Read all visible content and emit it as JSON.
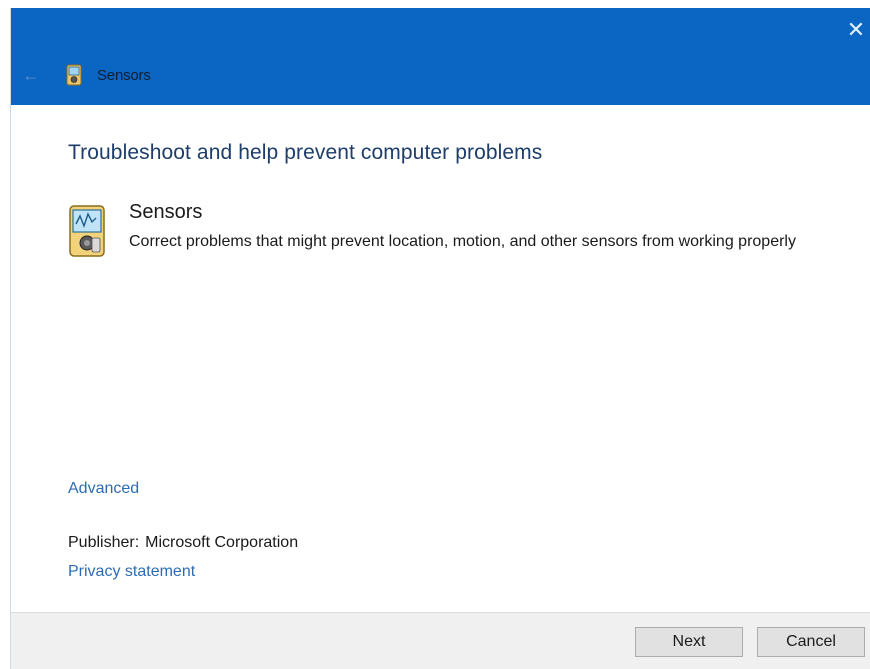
{
  "titlebar": {
    "title": "Sensors",
    "close_symbol": "✕",
    "back_symbol": "←",
    "icon": "sensor-device-icon",
    "color": "#0a66c2"
  },
  "main": {
    "heading": "Troubleshoot and help prevent computer problems",
    "tool": {
      "name": "Sensors",
      "description": "Correct problems that might prevent location, motion, and other sensors from working properly",
      "icon": "sensor-device-icon"
    },
    "advanced_link": "Advanced",
    "publisher_label": "Publisher:",
    "publisher_value": "Microsoft Corporation",
    "privacy_link": "Privacy statement"
  },
  "footer": {
    "next_label": "Next",
    "cancel_label": "Cancel"
  },
  "colors": {
    "accent": "#0a66c2",
    "link": "#2d6cb5",
    "heading": "#1e3d6b"
  }
}
